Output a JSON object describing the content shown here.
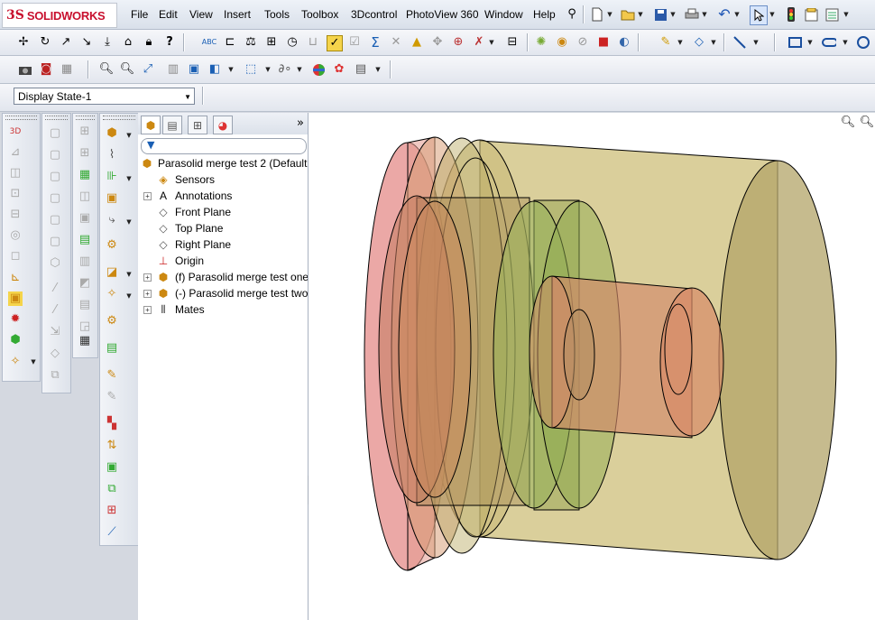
{
  "app": {
    "logo_ds": "3S",
    "logo_text": "SOLIDWORKS"
  },
  "menu": [
    "File",
    "Edit",
    "View",
    "Insert",
    "Tools",
    "Toolbox",
    "3Dcontrol",
    "PhotoView 360",
    "Window",
    "Help"
  ],
  "display_state": {
    "value": "Display State-1"
  },
  "tree": {
    "collapse_glyph": "»",
    "root": "Parasolid merge test 2  (Default",
    "nodes": [
      {
        "label": "Sensors",
        "icon": "sensor-icon",
        "expandable": false
      },
      {
        "label": "Annotations",
        "icon": "annotations-icon",
        "expandable": true
      },
      {
        "label": "Front Plane",
        "icon": "plane-icon",
        "expandable": false
      },
      {
        "label": "Top Plane",
        "icon": "plane-icon",
        "expandable": false
      },
      {
        "label": "Right Plane",
        "icon": "plane-icon",
        "expandable": false
      },
      {
        "label": "Origin",
        "icon": "origin-icon",
        "expandable": false
      },
      {
        "label": "(f) Parasolid merge test one",
        "icon": "part-icon",
        "expandable": true
      },
      {
        "label": "(-) Parasolid merge test two",
        "icon": "part-icon",
        "expandable": true
      },
      {
        "label": "Mates",
        "icon": "mates-icon",
        "expandable": true
      }
    ]
  },
  "colors": {
    "brand_red": "#c8102e",
    "selection_blue": "#2a5db0"
  }
}
